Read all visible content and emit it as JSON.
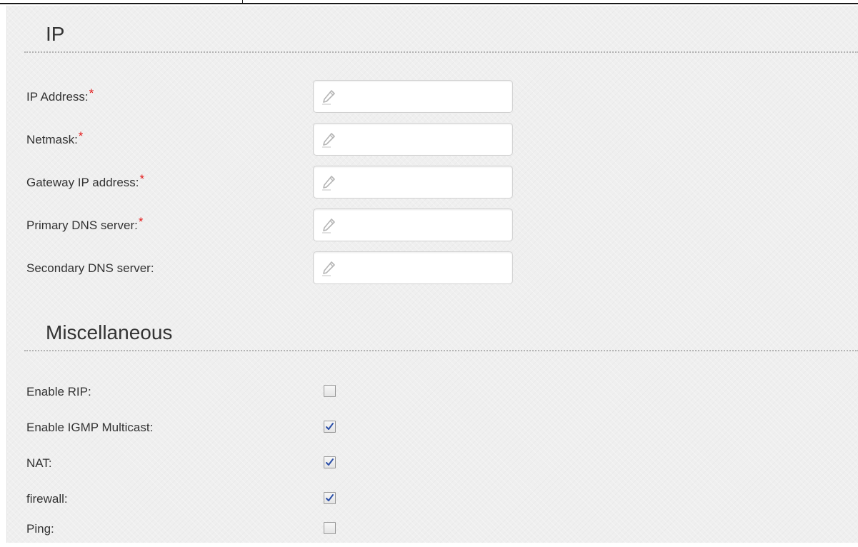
{
  "ip_section": {
    "title": "IP",
    "fields": [
      {
        "label": "IP Address:",
        "required": "*",
        "value": ""
      },
      {
        "label": "Netmask:",
        "required": "*",
        "value": ""
      },
      {
        "label": "Gateway IP address:",
        "required": "*",
        "value": ""
      },
      {
        "label": "Primary DNS server:",
        "required": "*",
        "value": ""
      },
      {
        "label": "Secondary DNS server:",
        "required": "",
        "value": ""
      }
    ]
  },
  "misc_section": {
    "title": "Miscellaneous",
    "options": [
      {
        "label": "Enable RIP:",
        "checked": false
      },
      {
        "label": "Enable IGMP Multicast:",
        "checked": true
      },
      {
        "label": "NAT:",
        "checked": true
      },
      {
        "label": "firewall:",
        "checked": true
      },
      {
        "label": "Ping:",
        "checked": false
      }
    ]
  },
  "icons": {
    "field_icon": "pencil-icon",
    "check_mark": "check-icon"
  },
  "colors": {
    "required_marker": "#e31b1b",
    "check_mark": "#2b4fa8",
    "panel_background": "#efefef"
  }
}
